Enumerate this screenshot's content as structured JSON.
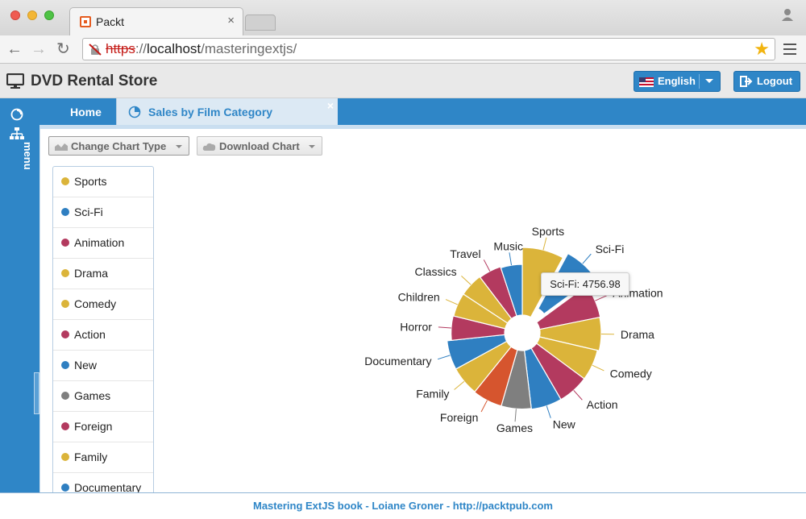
{
  "browser": {
    "tab_title": "Packt",
    "tab_close": "×",
    "url_scheme": "https",
    "url_sep": "://",
    "url_host": "localhost",
    "url_path": "/masteringextjs/"
  },
  "header": {
    "title": "DVD Rental Store",
    "language_label": "English",
    "logout_label": "Logout"
  },
  "sidebar": {
    "label": "menu"
  },
  "tabs": [
    {
      "label": "Home"
    },
    {
      "label": "Sales by Film Category",
      "close": "×"
    }
  ],
  "toolbar": {
    "change_chart_type": "Change Chart Type",
    "download_chart": "Download Chart"
  },
  "legend": {
    "items": [
      {
        "label": "Sports",
        "color": "#dbb43a"
      },
      {
        "label": "Sci-Fi",
        "color": "#2f7fc1"
      },
      {
        "label": "Animation",
        "color": "#b33a5f"
      },
      {
        "label": "Drama",
        "color": "#dbb43a"
      },
      {
        "label": "Comedy",
        "color": "#dbb43a"
      },
      {
        "label": "Action",
        "color": "#b33a5f"
      },
      {
        "label": "New",
        "color": "#2f7fc1"
      },
      {
        "label": "Games",
        "color": "#7f7f7f"
      },
      {
        "label": "Foreign",
        "color": "#b33a5f"
      },
      {
        "label": "Family",
        "color": "#dbb43a"
      },
      {
        "label": "Documentary",
        "color": "#2f7fc1"
      }
    ]
  },
  "chart_data": {
    "type": "pie",
    "donut": true,
    "categories": [
      "Sports",
      "Sci-Fi",
      "Animation",
      "Drama",
      "Comedy",
      "Action",
      "New",
      "Games",
      "Foreign",
      "Family",
      "Documentary",
      "Horror",
      "Children",
      "Classics",
      "Travel",
      "Music"
    ],
    "values": [
      5314,
      4757,
      4656,
      4587,
      4384,
      4375,
      4362,
      4281,
      4270,
      4227,
      4218,
      3722,
      3655,
      3640,
      3550,
      3418
    ],
    "colors": [
      "#dbb43a",
      "#2f7fc1",
      "#b33a5f",
      "#dbb43a",
      "#dbb43a",
      "#b33a5f",
      "#2f7fc1",
      "#7f7f7f",
      "#d6552e",
      "#dbb43a",
      "#2f7fc1",
      "#b33a5f",
      "#dbb43a",
      "#dbb43a",
      "#b33a5f",
      "#2f7fc1"
    ],
    "highlighted": "Sci-Fi",
    "tooltip": "Sci-Fi: 4756.98",
    "labels_visible": [
      "Sports",
      "Sci-Fi",
      "Animation",
      "Drama",
      "Comedy",
      "Action",
      "New",
      "Games",
      "Foreign",
      "Family",
      "Documentary",
      "Horror",
      "Children",
      "Classics",
      "Travel",
      "Music"
    ]
  },
  "footer": {
    "text": "Mastering ExtJS book - Loiane Groner - http://packtpub.com"
  }
}
